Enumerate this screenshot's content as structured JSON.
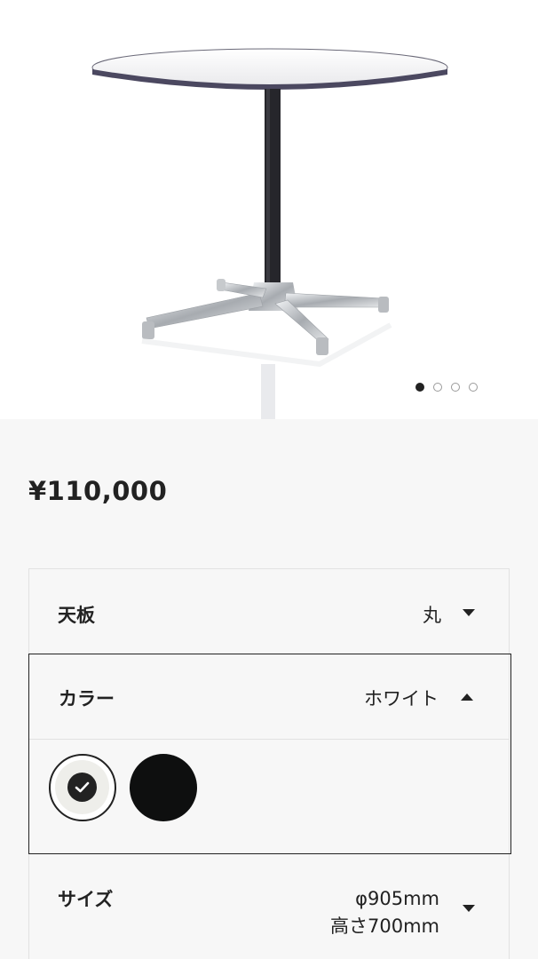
{
  "gallery": {
    "image_alt": "round table product image",
    "slide_count": 4,
    "active_slide": 1
  },
  "price": "¥110,000",
  "options": {
    "top": {
      "label": "天板",
      "value": "丸"
    },
    "color": {
      "label": "カラー",
      "value": "ホワイト",
      "swatches": [
        {
          "name": "white",
          "hex": "#eeeeea",
          "selected": true
        },
        {
          "name": "black",
          "hex": "#0e0f0f",
          "selected": false
        }
      ]
    },
    "size": {
      "label": "サイズ",
      "value_line1": "φ905mm",
      "value_line2": "高さ700mm"
    }
  }
}
